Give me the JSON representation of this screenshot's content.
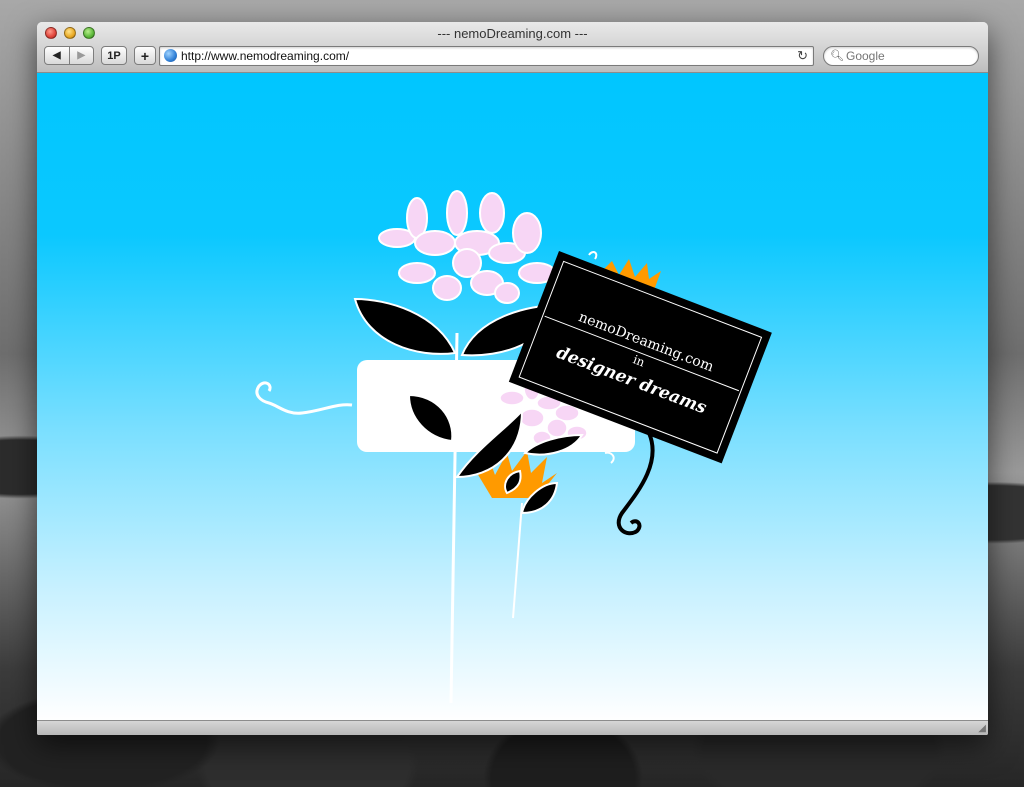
{
  "window": {
    "title": "--- nemoDreaming.com ---"
  },
  "toolbar": {
    "back_icon": "◀",
    "forward_icon": "▶",
    "onepassword_label": "1P",
    "add_label": "+",
    "url": "http://www.nemodreaming.com/",
    "reload_icon": "↻",
    "search_placeholder": "Google"
  },
  "page": {
    "card": {
      "line1": "nemoDreaming.com",
      "line2": "in",
      "line3": "designer dreams"
    }
  },
  "colors": {
    "sky_top": "#00c6ff",
    "sky_bottom": "#ffffff",
    "flower_pink": "#f7d6f5",
    "accent_orange": "#ff9a00",
    "card_black": "#000000"
  }
}
